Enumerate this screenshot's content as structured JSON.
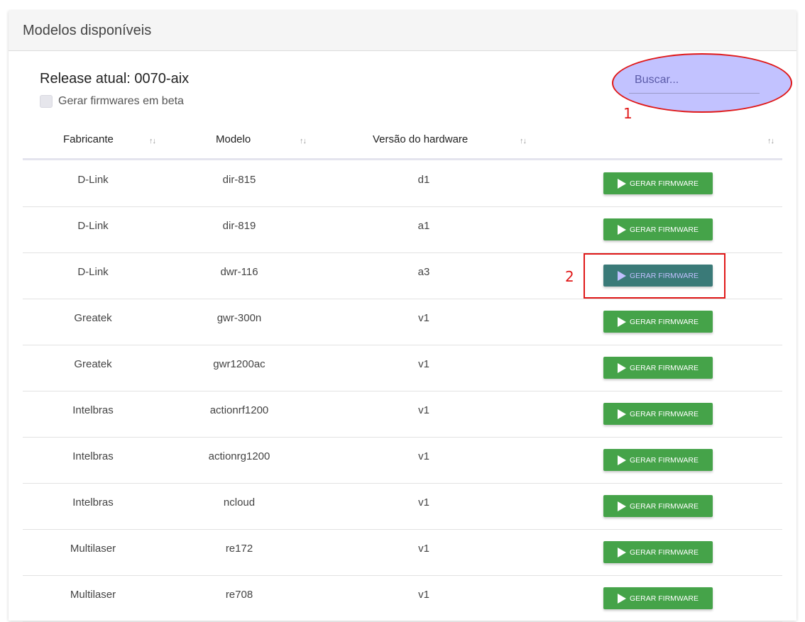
{
  "card": {
    "title": "Modelos disponíveis"
  },
  "release": {
    "label": "Release atual: 0070-aix"
  },
  "beta": {
    "label": "Gerar firmwares em beta",
    "checked": false
  },
  "search": {
    "placeholder": "Buscar..."
  },
  "annotations": {
    "marker_1": "1",
    "marker_2": "2",
    "color": "#e01818"
  },
  "table": {
    "columns": [
      "Fabricante",
      "Modelo",
      "Versão do hardware",
      ""
    ],
    "sort_icon": "↑↓",
    "action_label": "GERAR FIRMWARE",
    "action_icon": "play-icon",
    "rows": [
      {
        "fabricante": "D-Link",
        "modelo": "dir-815",
        "versao": "d1"
      },
      {
        "fabricante": "D-Link",
        "modelo": "dir-819",
        "versao": "a1"
      },
      {
        "fabricante": "D-Link",
        "modelo": "dwr-116",
        "versao": "a3"
      },
      {
        "fabricante": "Greatek",
        "modelo": "gwr-300n",
        "versao": "v1"
      },
      {
        "fabricante": "Greatek",
        "modelo": "gwr1200ac",
        "versao": "v1"
      },
      {
        "fabricante": "Intelbras",
        "modelo": "actionrf1200",
        "versao": "v1"
      },
      {
        "fabricante": "Intelbras",
        "modelo": "actionrg1200",
        "versao": "v1"
      },
      {
        "fabricante": "Intelbras",
        "modelo": "ncloud",
        "versao": "v1"
      },
      {
        "fabricante": "Multilaser",
        "modelo": "re172",
        "versao": "v1"
      },
      {
        "fabricante": "Multilaser",
        "modelo": "re708",
        "versao": "v1"
      }
    ]
  },
  "colors": {
    "button_green": "#45a349",
    "highlight_fill": "#c2c2ff",
    "highlight_border": "#e01818"
  }
}
